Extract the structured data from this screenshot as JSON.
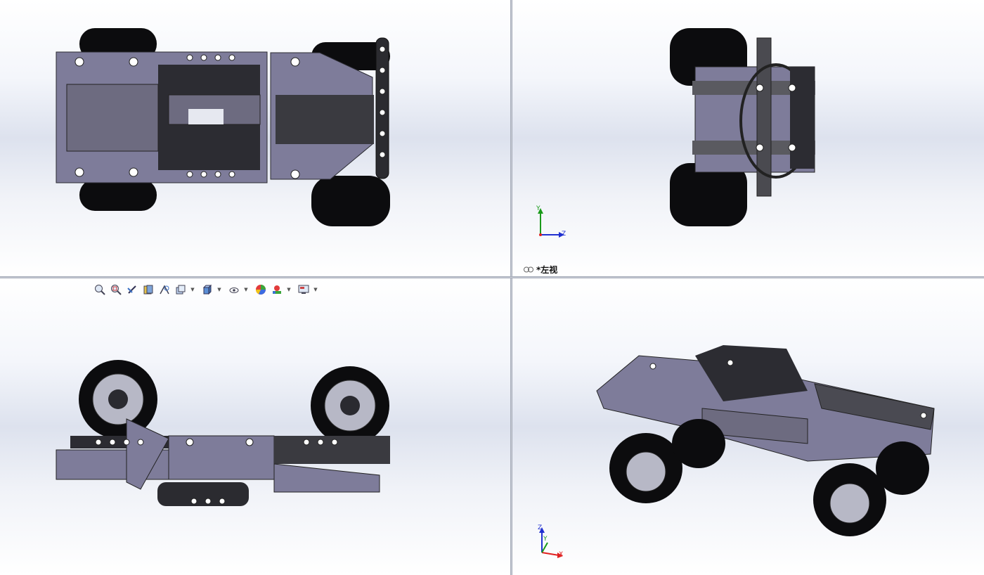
{
  "viewports": {
    "top_left": {
      "view": "top"
    },
    "top_right": {
      "view": "left",
      "label": "*左视",
      "triad": {
        "up": "Y",
        "right": "Z"
      }
    },
    "bottom_left": {
      "view": "front"
    },
    "bottom_right": {
      "view": "isometric",
      "triad": {
        "up": "Z",
        "right": "X",
        "depth": "Y"
      }
    }
  },
  "toolbar": {
    "icons": [
      "zoom-to-fit-icon",
      "zoom-to-area-icon",
      "previous-view-icon",
      "section-view-icon",
      "dynamic-annotation-icon",
      "view-orientation-icon",
      "display-style-icon",
      "hide-show-items-icon",
      "edit-appearance-icon",
      "apply-scene-icon",
      "view-settings-icon"
    ]
  },
  "colors": {
    "part_body": "#7e7c9a",
    "part_dark": "#3a3a40",
    "tire": "#0c0c0e",
    "rim": "#b7b8c6",
    "axis_x": "#e02020",
    "axis_y": "#1a9a1a",
    "axis_z": "#2030d0"
  }
}
